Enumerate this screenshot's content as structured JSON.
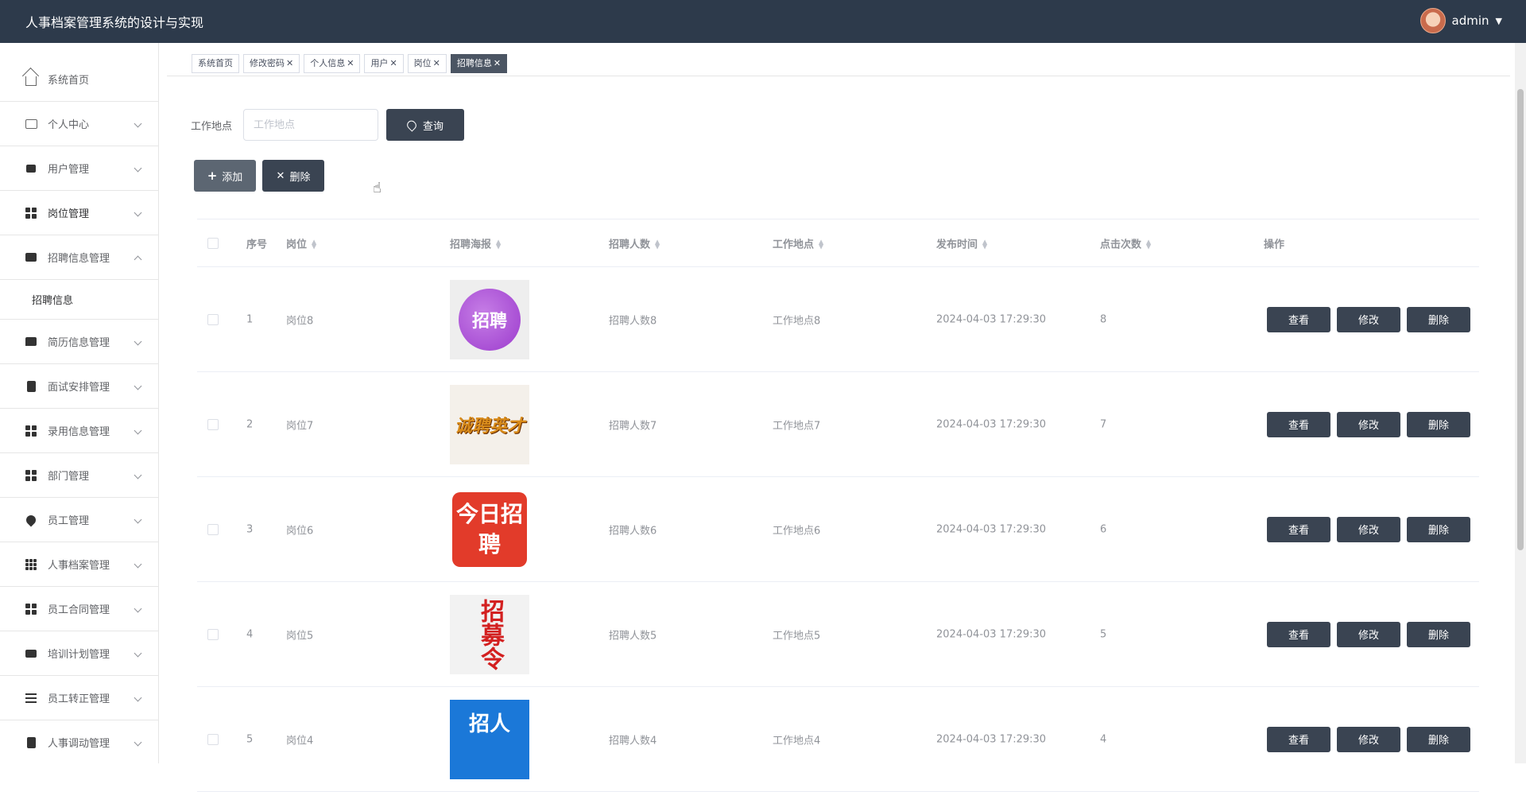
{
  "app": {
    "title": "人事档案管理系统的设计与实现",
    "user": "admin"
  },
  "sidebar": {
    "items": [
      {
        "label": "系统首页",
        "icon": "home-icon"
      },
      {
        "label": "个人中心",
        "icon": "card-icon"
      },
      {
        "label": "用户管理",
        "icon": "brush-icon"
      },
      {
        "label": "岗位管理",
        "icon": "grid-icon"
      },
      {
        "label": "招聘信息管理",
        "icon": "briefcase-icon"
      },
      {
        "label": "简历信息管理",
        "icon": "chat-icon"
      },
      {
        "label": "面试安排管理",
        "icon": "clipboard-icon"
      },
      {
        "label": "录用信息管理",
        "icon": "grid-icon"
      },
      {
        "label": "部门管理",
        "icon": "grid-icon"
      },
      {
        "label": "员工管理",
        "icon": "pin-icon"
      },
      {
        "label": "人事档案管理",
        "icon": "apps-icon"
      },
      {
        "label": "员工合同管理",
        "icon": "grid-icon"
      },
      {
        "label": "培训计划管理",
        "icon": "monitor-icon"
      },
      {
        "label": "员工转正管理",
        "icon": "list-icon"
      },
      {
        "label": "人事调动管理",
        "icon": "clipboard-check-icon"
      }
    ],
    "submenu": {
      "label": "招聘信息"
    }
  },
  "tabs": [
    {
      "label": "系统首页"
    },
    {
      "label": "修改密码"
    },
    {
      "label": "个人信息"
    },
    {
      "label": "用户"
    },
    {
      "label": "岗位"
    },
    {
      "label": "招聘信息"
    }
  ],
  "search": {
    "label": "工作地点",
    "placeholder": "工作地点",
    "button": "查询"
  },
  "toolbar": {
    "add": "添加",
    "delete": "删除"
  },
  "table": {
    "headers": [
      "序号",
      "岗位",
      "招聘海报",
      "招聘人数",
      "工作地点",
      "发布时间",
      "点击次数",
      "操作"
    ],
    "rows": [
      {
        "no": "1",
        "post": "岗位8",
        "poster_text": "招聘",
        "count": "招聘人数8",
        "place": "工作地点8",
        "time": "2024-04-03 17:29:30",
        "clicks": "8"
      },
      {
        "no": "2",
        "post": "岗位7",
        "poster_text": "诚聘英才",
        "count": "招聘人数7",
        "place": "工作地点7",
        "time": "2024-04-03 17:29:30",
        "clicks": "7"
      },
      {
        "no": "3",
        "post": "岗位6",
        "poster_text": "今日招聘",
        "count": "招聘人数6",
        "place": "工作地点6",
        "time": "2024-04-03 17:29:30",
        "clicks": "6"
      },
      {
        "no": "4",
        "post": "岗位5",
        "poster_text": "招募令",
        "count": "招聘人数5",
        "place": "工作地点5",
        "time": "2024-04-03 17:29:30",
        "clicks": "5"
      },
      {
        "no": "5",
        "post": "岗位4",
        "poster_text": "招人",
        "count": "招聘人数4",
        "place": "工作地点4",
        "time": "2024-04-03 17:29:30",
        "clicks": "4"
      }
    ],
    "actions": {
      "view": "查看",
      "edit": "修改",
      "delete": "删除"
    }
  },
  "colors": {
    "header_bg": "#2d3a4b",
    "button_dark": "#3a4452",
    "active_tab": "#4b5563"
  }
}
